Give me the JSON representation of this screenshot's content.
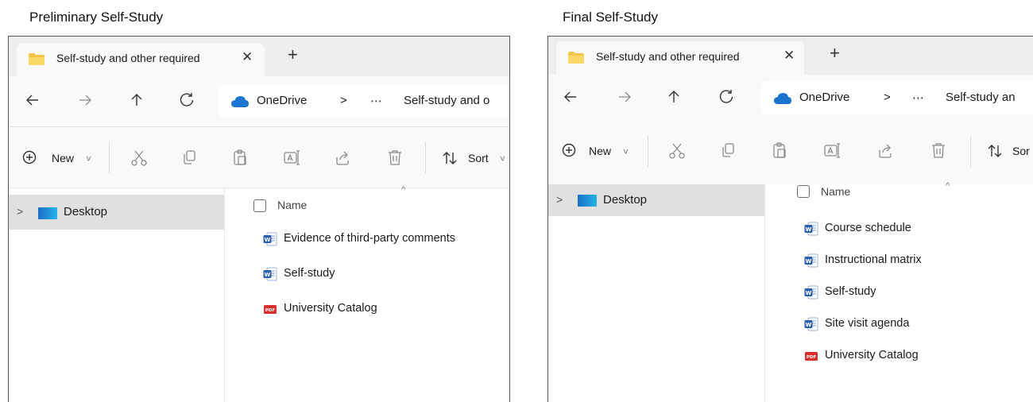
{
  "captions": {
    "left": "Preliminary Self-Study",
    "right": "Final Self-Study"
  },
  "windows": [
    {
      "tab": {
        "title": "Self-study and other required",
        "close": "✕"
      },
      "new_tab": "+",
      "address": {
        "root": "OneDrive",
        "sep": ">",
        "more": "⋯",
        "current": "Self-study and o"
      },
      "toolbar": {
        "new_label": "New",
        "new_caret": "˅",
        "sort_label": "Sort",
        "sort_caret": "˅"
      },
      "nav": {
        "chevron": ">",
        "item": "Desktop"
      },
      "list": {
        "header": "Name",
        "sort_caret": "^",
        "files": [
          {
            "name": "Evidence of third-party comments",
            "type": "word",
            "icon_text": "W"
          },
          {
            "name": "Self-study",
            "type": "word",
            "icon_text": "W"
          },
          {
            "name": "University Catalog",
            "type": "pdf",
            "icon_text": "PDF"
          }
        ]
      }
    },
    {
      "tab": {
        "title": "Self-study and other required",
        "close": "✕"
      },
      "new_tab": "+",
      "address": {
        "root": "OneDrive",
        "sep": ">",
        "more": "⋯",
        "current": "Self-study an"
      },
      "toolbar": {
        "new_label": "New",
        "new_caret": "˅",
        "sort_label": "Sor",
        "sort_caret": ""
      },
      "nav": {
        "chevron": ">",
        "item": "Desktop"
      },
      "list": {
        "header": "Name",
        "sort_caret": "^",
        "files": [
          {
            "name": "Course schedule",
            "type": "word",
            "icon_text": "W"
          },
          {
            "name": "Instructional matrix",
            "type": "word",
            "icon_text": "W"
          },
          {
            "name": "Self-study",
            "type": "word",
            "icon_text": "W"
          },
          {
            "name": "Site visit agenda",
            "type": "word",
            "icon_text": "W"
          },
          {
            "name": "University Catalog",
            "type": "pdf",
            "icon_text": "PDF"
          }
        ]
      }
    }
  ],
  "colors": {
    "word": "#2b5fb4",
    "pdf": "#d9302c",
    "folder": "#f4c54a",
    "cloud": "#1b74cf",
    "selection": "#e0e0e0"
  }
}
